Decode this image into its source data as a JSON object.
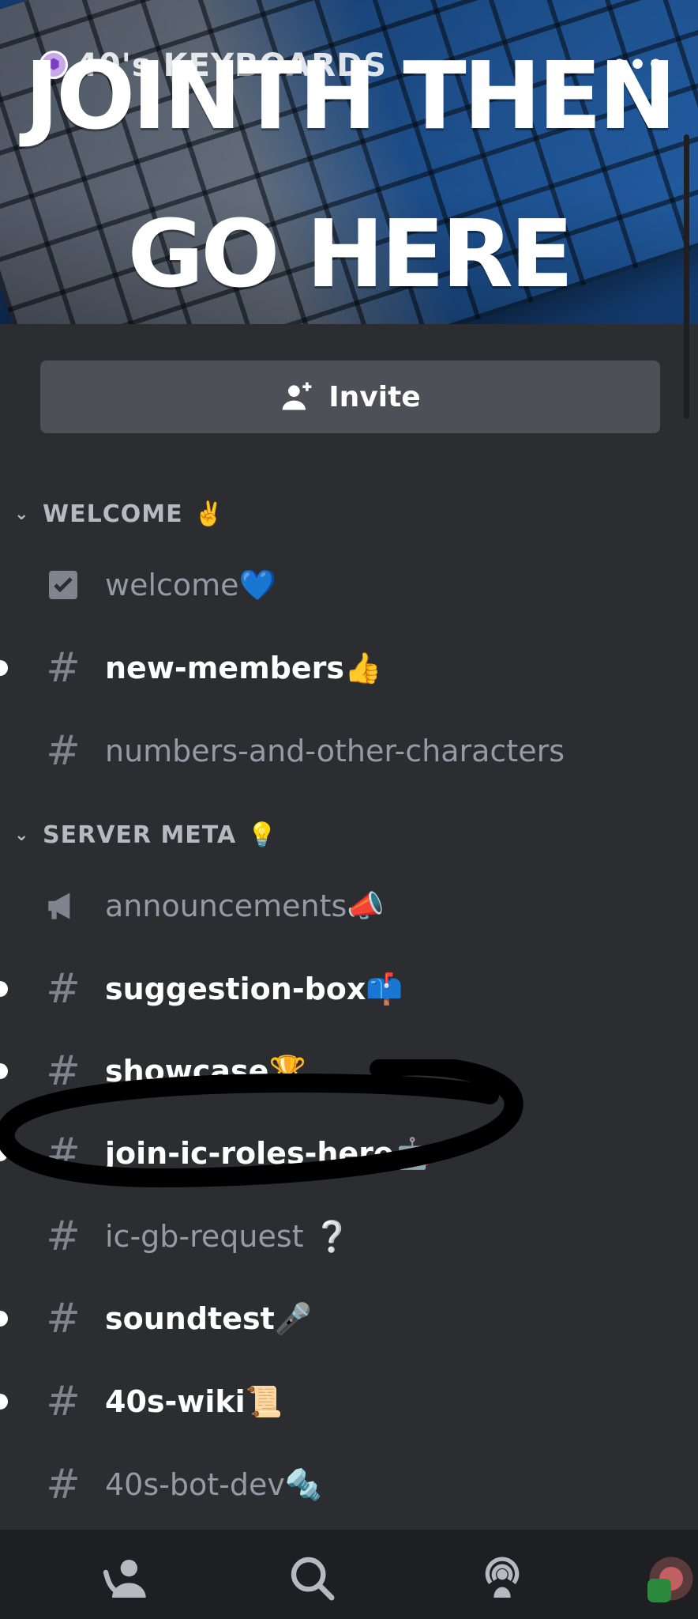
{
  "banner": {
    "server_name": "40's KEYBOARDS",
    "overlay_line1": "JOINTH THEN",
    "overlay_line2": "GO HERE",
    "menu_dots": "•••"
  },
  "invite": {
    "label": "Invite",
    "icon": "add-user-icon"
  },
  "categories": [
    {
      "label": "WELCOME",
      "emoji": "✌️"
    },
    {
      "label": "SERVER META",
      "emoji": "💡"
    }
  ],
  "channels": [
    {
      "name": "welcome",
      "emoji": "💙",
      "icon": "rules-icon",
      "unread": false
    },
    {
      "name": "new-members",
      "emoji": "👍",
      "icon": "hash-icon",
      "unread": true
    },
    {
      "name": "numbers-and-other-characters",
      "emoji": "",
      "icon": "hash-icon",
      "unread": false
    },
    {
      "name": "announcements",
      "emoji": "📣",
      "icon": "megaphone-icon",
      "unread": false
    },
    {
      "name": "suggestion-box",
      "emoji": "📫",
      "icon": "hash-icon",
      "unread": true
    },
    {
      "name": "showcase",
      "emoji": "🏆",
      "icon": "hash-icon",
      "unread": true
    },
    {
      "name": "join-ic-roles-here",
      "emoji": "🤖",
      "icon": "hash-icon",
      "unread": true
    },
    {
      "name": "ic-gb-request",
      "emoji": "❔",
      "icon": "hash-icon",
      "unread": false
    },
    {
      "name": "soundtest",
      "emoji": "🎤",
      "icon": "hash-icon",
      "unread": true
    },
    {
      "name": "40s-wiki",
      "emoji": "📜",
      "icon": "hash-icon",
      "unread": true
    },
    {
      "name": "40s-bot-dev",
      "emoji": "🔩",
      "icon": "hash-icon",
      "unread": false
    }
  ],
  "bottom_nav": [
    {
      "icon": "friends-icon"
    },
    {
      "icon": "search-icon"
    },
    {
      "icon": "stage-icon"
    },
    {
      "icon": "profile-avatar-icon"
    }
  ],
  "colors": {
    "background": "#2b2d31",
    "invite_button": "#4e5058",
    "unread_text": "#ffffff",
    "muted_text": "#949ba4",
    "annotation": "#000000"
  }
}
